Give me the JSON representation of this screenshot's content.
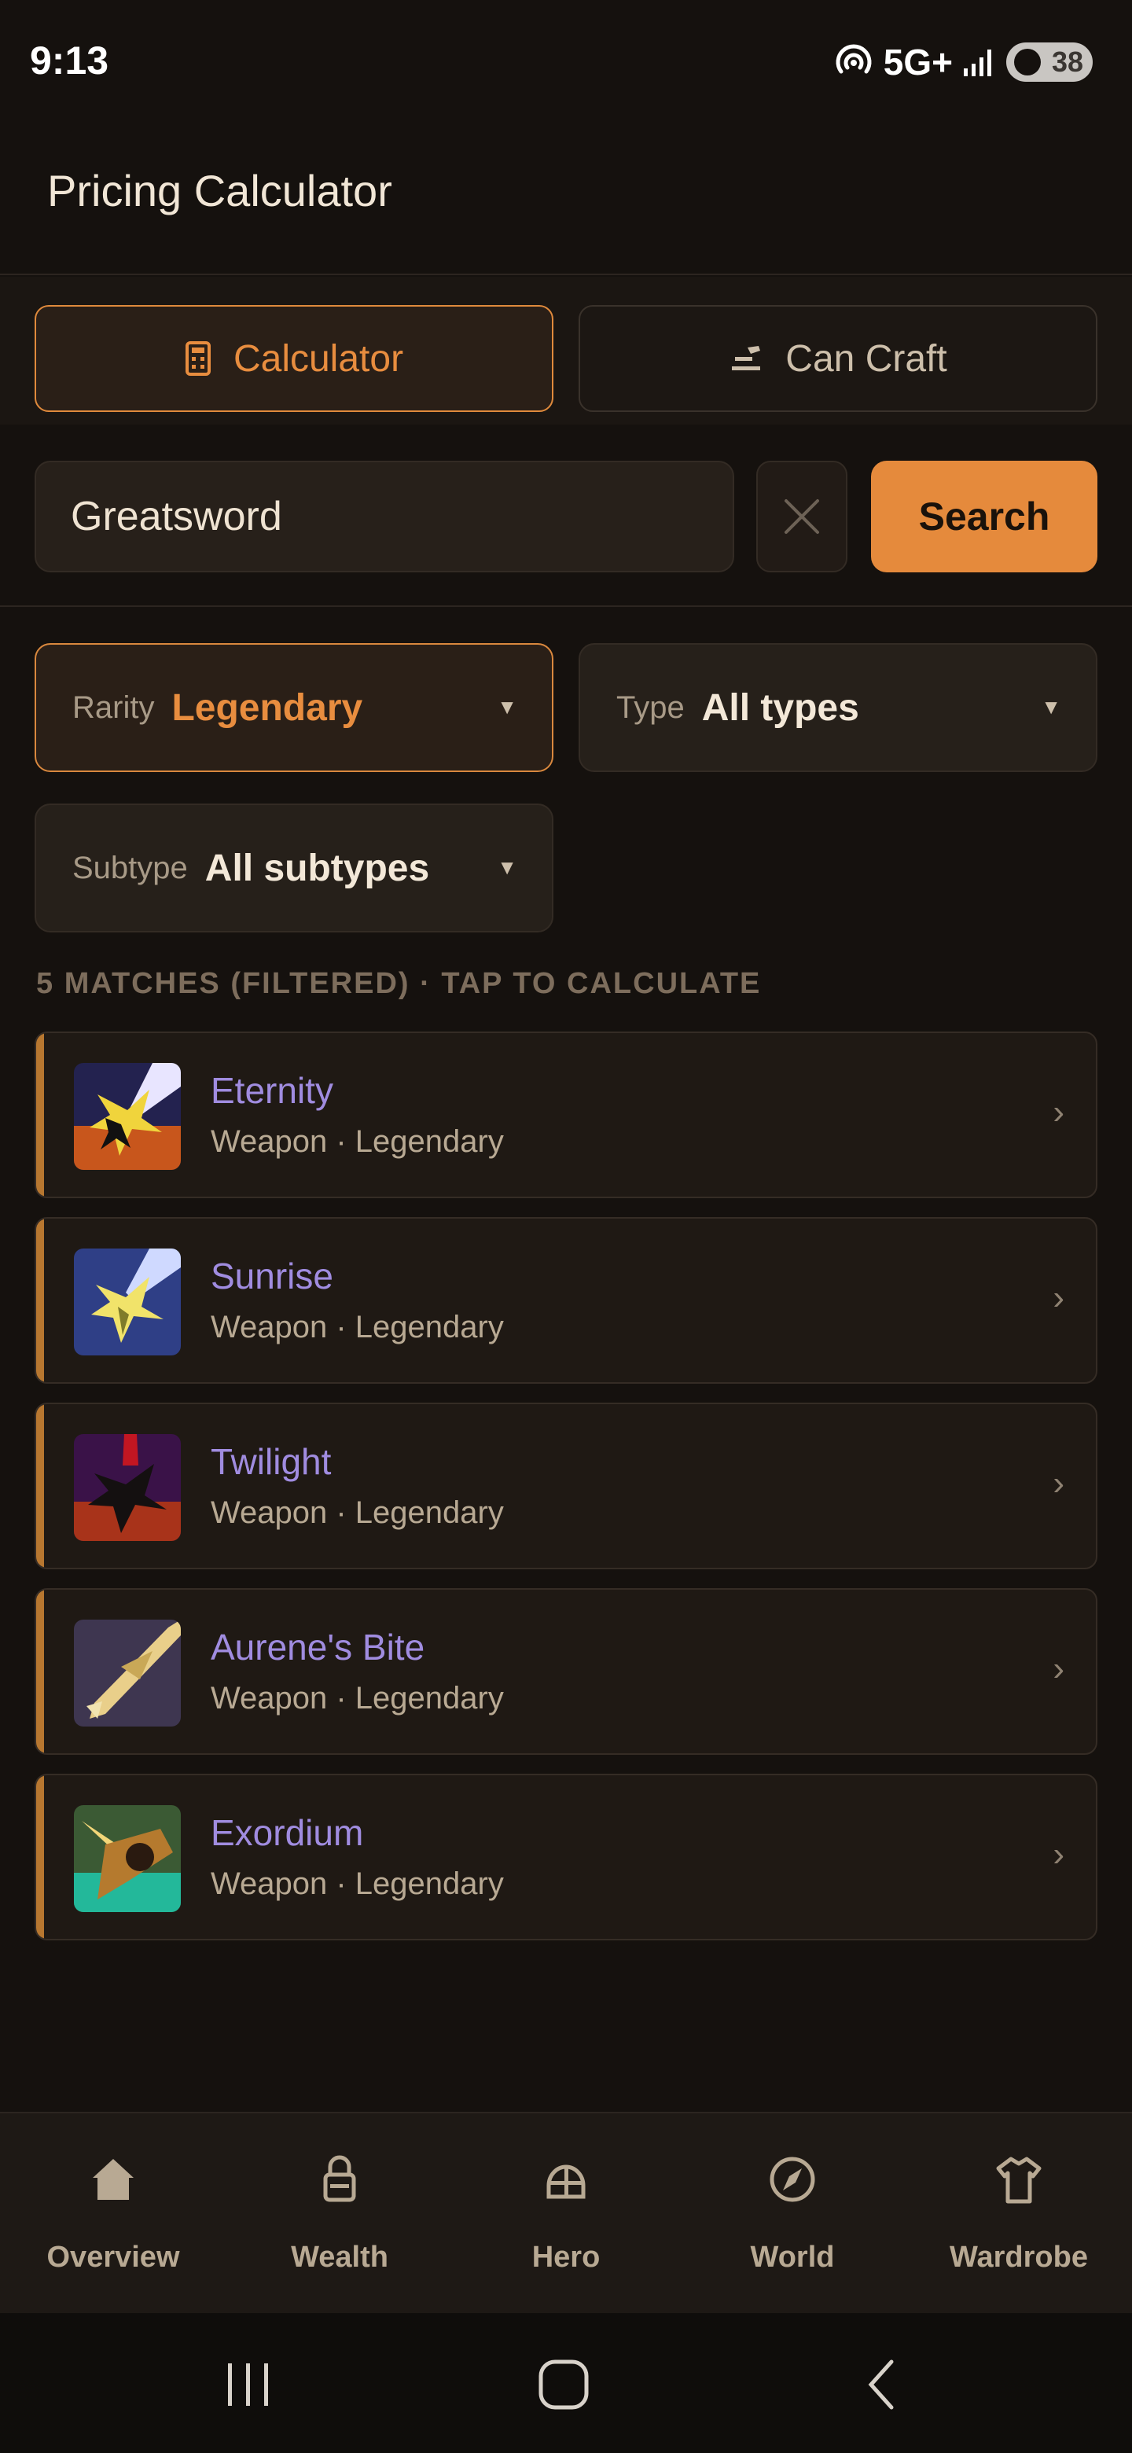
{
  "status_bar": {
    "time": "9:13",
    "network": "5G+",
    "battery": "38"
  },
  "app": {
    "title": "Pricing Calculator"
  },
  "modes": {
    "calculator_label": "Calculator",
    "can_craft_label": "Can Craft",
    "selected": "Calculator"
  },
  "search": {
    "value": "Greatsword",
    "button_label": "Search"
  },
  "filters": {
    "rarity": {
      "label": "Rarity",
      "value": "Legendary"
    },
    "type": {
      "label": "Type",
      "value": "All types"
    },
    "subtype": {
      "label": "Subtype",
      "value": "All subtypes"
    }
  },
  "results": {
    "caption": "5 MATCHES (FILTERED) · TAP TO CALCULATE",
    "items": [
      {
        "name": "Eternity",
        "meta": "Weapon · Legendary",
        "icon": "eternity-thumbnail"
      },
      {
        "name": "Sunrise",
        "meta": "Weapon · Legendary",
        "icon": "sunrise-thumbnail"
      },
      {
        "name": "Twilight",
        "meta": "Weapon · Legendary",
        "icon": "twilight-thumbnail"
      },
      {
        "name": "Aurene's Bite",
        "meta": "Weapon · Legendary",
        "icon": "aurenes-bite-thumbnail"
      },
      {
        "name": "Exordium",
        "meta": "Weapon · Legendary",
        "icon": "exordium-thumbnail"
      }
    ]
  },
  "bottom_nav": {
    "items": [
      {
        "label": "Overview",
        "icon": "home-icon"
      },
      {
        "label": "Wealth",
        "icon": "lock-icon"
      },
      {
        "label": "Hero",
        "icon": "helmet-icon"
      },
      {
        "label": "World",
        "icon": "compass-icon"
      },
      {
        "label": "Wardrobe",
        "icon": "shirt-icon"
      }
    ]
  },
  "colors": {
    "accent": "#e58a3c",
    "item_name": "#a08ce0",
    "background": "#15110e",
    "legendary_stripe": "#b77730"
  }
}
